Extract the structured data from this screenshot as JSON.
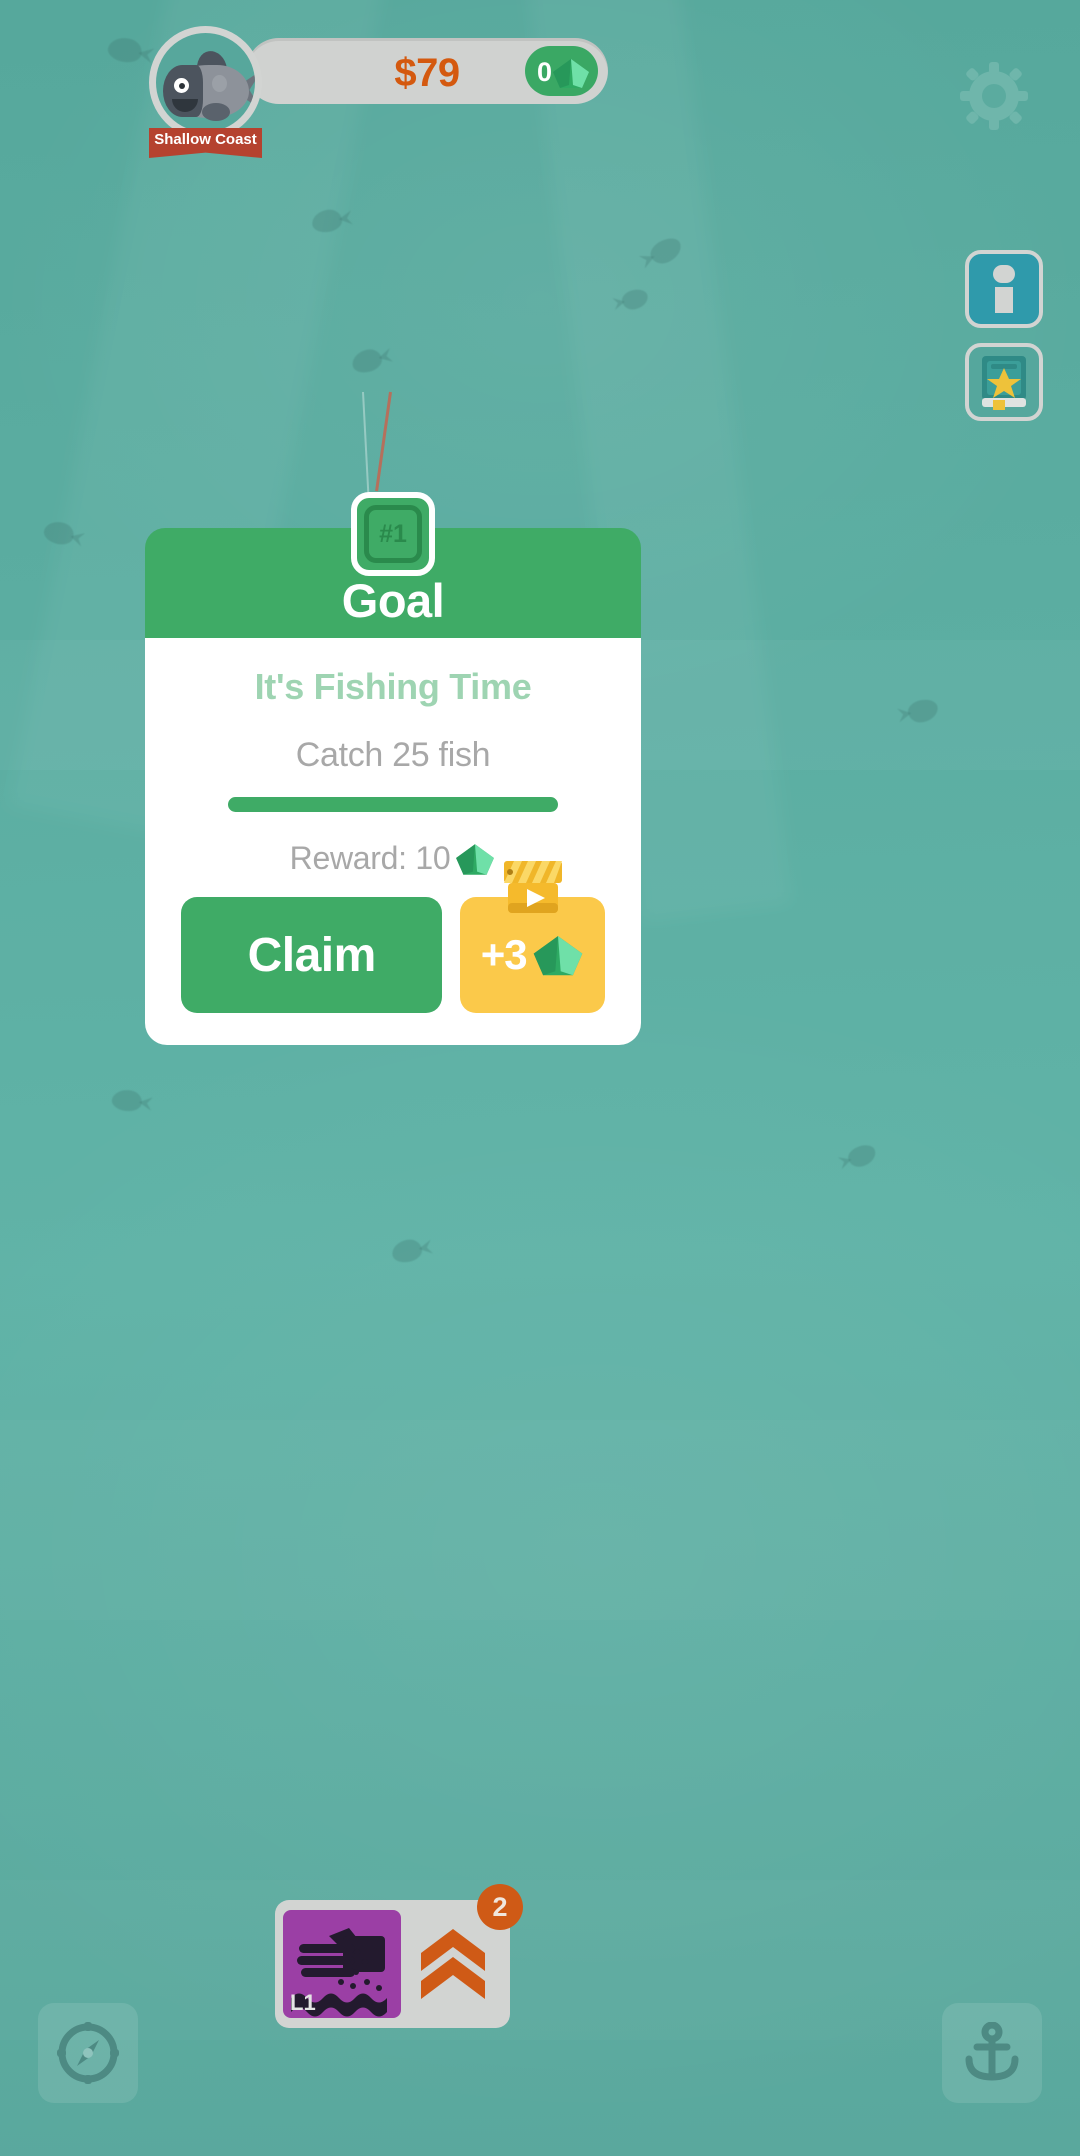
{
  "topbar": {
    "money": "$79",
    "gems": "0",
    "region_label": "Shallow Coast",
    "fish_avatar_icon": "fish-avatar-icon",
    "gem_icon": "gem-icon",
    "settings_icon": "gear-icon"
  },
  "side_buttons": [
    {
      "name": "info-button",
      "icon": "info-icon"
    },
    {
      "name": "encyclopedia-button",
      "icon": "book-star-icon"
    }
  ],
  "dialog": {
    "title": "Goal",
    "number": "#1",
    "goal_name": "It's Fishing Time",
    "goal_desc": "Catch 25 fish",
    "progress_percent": 100,
    "reward_label": "Reward: 10",
    "reward_gem_icon": "gem-icon",
    "claim_label": "Claim",
    "ad_amount": "+3",
    "ad_gem_icon": "gem-icon",
    "ad_video_icon": "clapperboard-play-icon"
  },
  "hud": {
    "bait_level": "L1",
    "bait_icon": "hand-scatter-bait-icon",
    "upgrade_icon": "double-chevron-up-icon",
    "upgrade_badge": "2"
  },
  "corner_buttons": [
    {
      "name": "map-button",
      "icon": "compass-icon"
    },
    {
      "name": "anchor-button",
      "icon": "anchor-icon"
    }
  ],
  "colors": {
    "water": "#5bab9f",
    "green": "#3fab66",
    "money_orange": "#d4590f",
    "yellow": "#fbc94a",
    "purple": "#9b3fa5",
    "badge_orange": "#cf5a16",
    "gem_green": "#2eaa63",
    "ribbon_red": "#b5422f"
  }
}
